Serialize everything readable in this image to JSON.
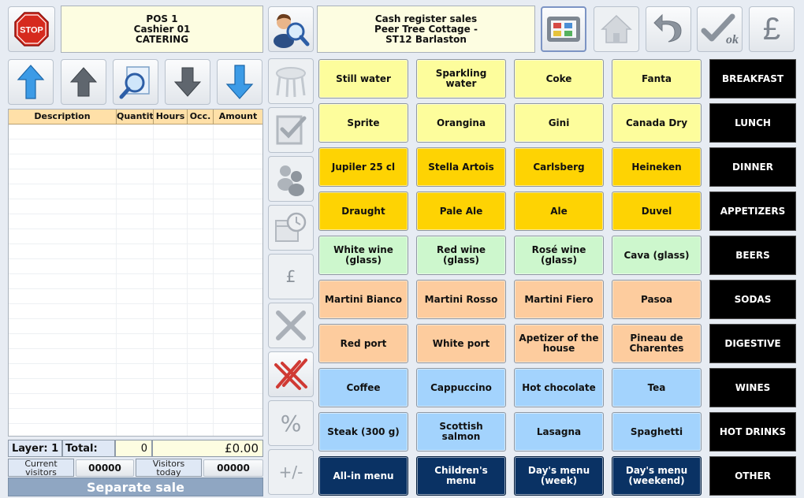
{
  "header": {
    "pos_info": [
      "POS 1",
      "Cashier 01",
      "CATERING"
    ],
    "store_info": [
      "Cash register sales",
      "Peer Tree Cottage -",
      "ST12 Barlaston"
    ],
    "stop_label": "STOP",
    "currency_glyph": "£"
  },
  "table": {
    "columns": [
      "Description",
      "Quantity",
      "Hours",
      "Occ.",
      "Amount"
    ]
  },
  "status": {
    "layer_label": "Layer: 1",
    "total_label": "Total:",
    "total_qty": "0",
    "total_amount": "£0.00",
    "current_visitors_label": "Current visitors",
    "current_visitors": "00000",
    "visitors_today_label": "Visitors today",
    "visitors_today": "00000",
    "separate_sale": "Separate sale"
  },
  "side_buttons": {
    "pound": "£",
    "percent": "%",
    "plusminus": "+/-"
  },
  "products": [
    [
      "Still water",
      "Sparkling water",
      "Coke",
      "Fanta"
    ],
    [
      "Sprite",
      "Orangina",
      "Gini",
      "Canada Dry"
    ],
    [
      "Jupiler 25 cl",
      "Stella Artois",
      "Carlsberg",
      "Heineken"
    ],
    [
      "Draught",
      "Pale Ale",
      "Ale",
      "Duvel"
    ],
    [
      "White wine (glass)",
      "Red wine (glass)",
      "Rosé wine (glass)",
      "Cava (glass)"
    ],
    [
      "Martini Bianco",
      "Martini Rosso",
      "Martini Fiero",
      "Pasoa"
    ],
    [
      "Red port",
      "White port",
      "Apetizer of the house",
      "Pineau de Charentes"
    ],
    [
      "Coffee",
      "Cappuccino",
      "Hot chocolate",
      "Tea"
    ],
    [
      "Steak (300 g)",
      "Scottish salmon",
      "Lasagna",
      "Spaghetti"
    ],
    [
      "All-in menu",
      "Children's menu",
      "Day's menu (week)",
      "Day's menu (weekend)"
    ]
  ],
  "row_colors": [
    "#fdfd9c",
    "#fdfd9c",
    "#fed303",
    "#fed303",
    "#cdf7cd",
    "#fdcc9e",
    "#fdcc9e",
    "#a3d3fd",
    "#a3d3fd",
    "#0a3264"
  ],
  "categories": [
    "BREAKFAST",
    "LUNCH",
    "DINNER",
    "APPETIZERS",
    "BEERS",
    "SODAS",
    "DIGESTIVE",
    "WINES",
    "HOT DRINKS",
    "OTHER"
  ]
}
